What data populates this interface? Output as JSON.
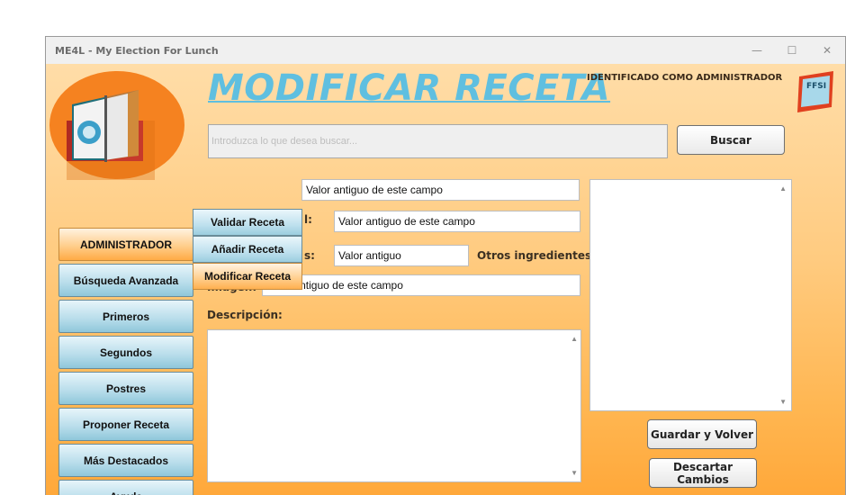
{
  "window": {
    "title": "ME4L - My Election For Lunch",
    "minimize": "—",
    "maximize": "☐",
    "close": "✕"
  },
  "header": {
    "title": "MODIFICAR RECETA",
    "identified": "IDENTIFICADO COMO ADMINISTRADOR",
    "badge": "FFSI"
  },
  "search": {
    "placeholder": "Introduzca lo que desea buscar...",
    "button": "Buscar"
  },
  "sidebar": {
    "items": [
      {
        "label": "ADMINISTRADOR",
        "active": true
      },
      {
        "label": "Búsqueda Avanzada"
      },
      {
        "label": "Primeros"
      },
      {
        "label": "Segundos"
      },
      {
        "label": "Postres"
      },
      {
        "label": "Proponer Receta"
      },
      {
        "label": "Más Destacados"
      },
      {
        "label": "Ayuda"
      }
    ]
  },
  "admin_menu": {
    "items": [
      {
        "label": "Validar Receta"
      },
      {
        "label": "Añadir Receta"
      },
      {
        "label": "Modificar Receta",
        "active": true
      }
    ]
  },
  "form": {
    "field1_value": "Valor antiguo de este campo",
    "field2_label_visible": "l:",
    "field2_value": "Valor antiguo de este campo",
    "field3_label_visible": "s:",
    "field3_value": "Valor antiguo",
    "otros_label": "Otros ingredientes:",
    "imagen_label": "Imágen:",
    "imagen_value": "Valor antiguo de este campo",
    "descripcion_label": "Descripción:"
  },
  "actions": {
    "save": "Guardar y Volver",
    "discard": "Descartar Cambios"
  },
  "colors": {
    "title": "#5fbfe0",
    "background": "#ffcb80",
    "sidebar": "#b6dcea",
    "active": "#ffaa45"
  }
}
